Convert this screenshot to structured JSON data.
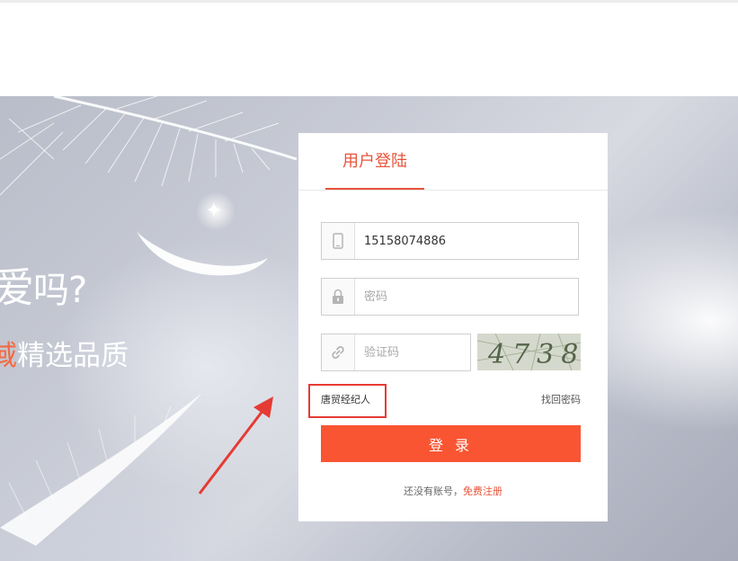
{
  "hero": {
    "slogan_line1_main": "爱",
    "slogan_line1_rest": "吗?",
    "slogan_line2_accent": "域",
    "slogan_line2_rest": "精选品质"
  },
  "login": {
    "tab_label": "用户登陆",
    "phone": {
      "value": "15158074886",
      "icon": "mobile-phone-icon"
    },
    "password": {
      "placeholder": "密码",
      "icon": "lock-icon"
    },
    "captcha": {
      "placeholder": "验证码",
      "icon": "link-icon",
      "image_text": "4738"
    },
    "role_label": "唐贸经纪人",
    "forgot_label": "找回密码",
    "submit_label": "登 录",
    "register_prompt": "还没有账号，",
    "register_link": "免费注册"
  },
  "colors": {
    "accent": "#e8543a",
    "button": "#fa5533",
    "highlight_box": "#e53b34",
    "annotation_arrow": "#e53b34"
  }
}
